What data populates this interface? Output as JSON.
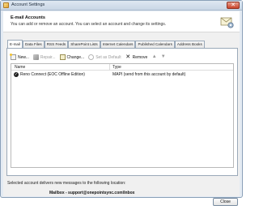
{
  "window": {
    "title": "Account Settings",
    "close_glyph": "✕"
  },
  "header": {
    "title": "E-mail Accounts",
    "subtitle": "You can add or remove an account. You can select an account and change its settings.",
    "art_icon": "envelope-cog-icon"
  },
  "tabs": [
    {
      "label": "E-mail",
      "active": true
    },
    {
      "label": "Data Files",
      "active": false
    },
    {
      "label": "RSS Feeds",
      "active": false
    },
    {
      "label": "SharePoint Lists",
      "active": false
    },
    {
      "label": "Internet Calendars",
      "active": false
    },
    {
      "label": "Published Calendars",
      "active": false
    },
    {
      "label": "Address Books",
      "active": false
    }
  ],
  "toolbar": {
    "new_label": "New...",
    "repair_label": "Repair...",
    "change_label": "Change...",
    "set_default_label": "Set as Default",
    "remove_label": "Remove",
    "remove_glyph": "✕",
    "up_glyph": "▲",
    "down_glyph": "▼"
  },
  "accounts_table": {
    "columns": [
      "Name",
      "Type"
    ],
    "rows": [
      {
        "name": "Reno Connect (EOC Offline Edition)",
        "type": "MAPI (send from this account by default)",
        "check_glyph": "✓"
      }
    ]
  },
  "delivery": {
    "text": "Selected account delivers new messages to the following location:",
    "mailbox": "Mailbox - support@onepointsync.com\\Inbox"
  },
  "buttons": {
    "close_label": "Close"
  }
}
